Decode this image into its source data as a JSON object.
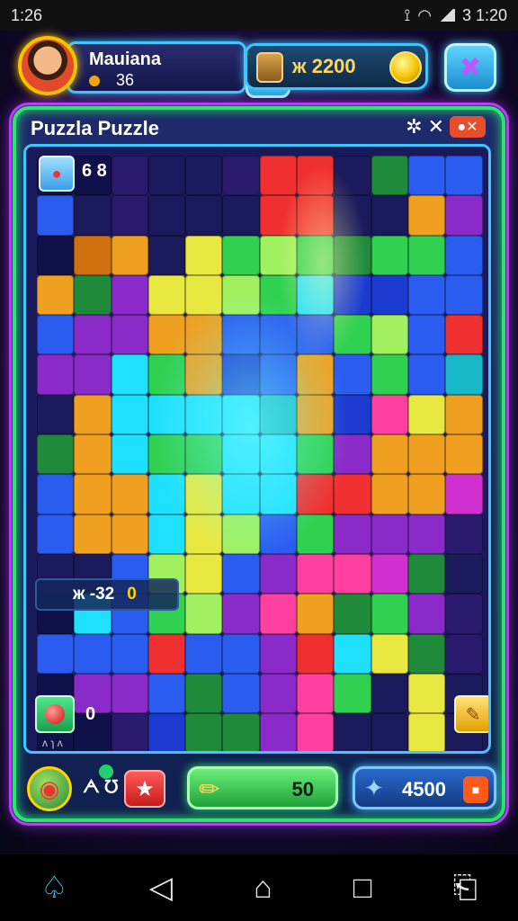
{
  "status_bar": {
    "time_left": "1:26",
    "time_right": "3 1:20"
  },
  "header": {
    "username": "Mauiana",
    "level": "36",
    "add_label": "✚",
    "coins": "ж 2200",
    "settings_icon": "puzzle-piece-icon"
  },
  "panel": {
    "title": "Puzzla Puzzle",
    "controls": [
      "✲",
      "✕",
      "●✕"
    ]
  },
  "board": {
    "pieces_counter": "6 8",
    "timer": "ж -32",
    "timer_suffix": "0",
    "bottom_left_count": "0",
    "bottom_left_small": "ᴧ ɿ ᴧ"
  },
  "tools": {
    "combo_label": "ᗅ ℧",
    "hint_value": "50",
    "score": "4500",
    "star_label": "★"
  },
  "colors": {
    "panel_border": "#28e86a",
    "outer_glow": "#b63cff",
    "accent": "#3ec6ff"
  },
  "nav": {
    "home_icon": "home-icon",
    "back_icon": "back-icon",
    "recents_icon": "recents-icon"
  }
}
